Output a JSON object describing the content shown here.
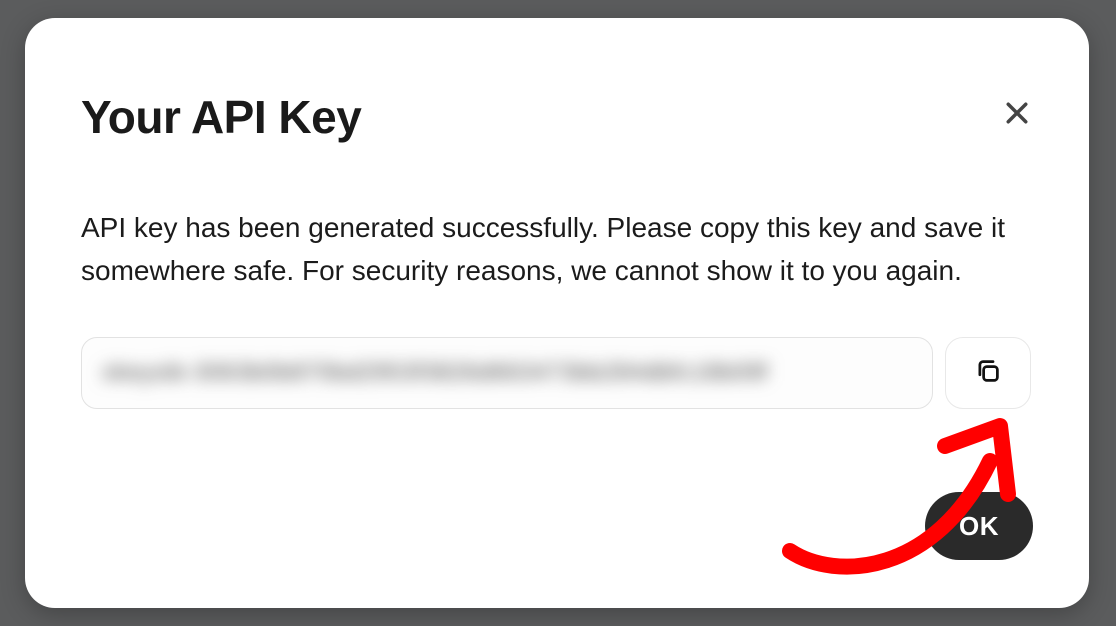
{
  "modal": {
    "title": "Your API Key",
    "description": "API key has been generated successfully. Please copy this key and save it somewhere safe. For security reasons, we cannot show it to you again.",
    "api_key_value": "xkeysib-3063b0b870bd2953f3826d663473bb284dbfc18b09f",
    "ok_label": "OK"
  },
  "icons": {
    "close": "close-icon",
    "copy": "copy-icon"
  },
  "annotation": {
    "type": "arrow",
    "color": "#ff0000",
    "target": "copy-button"
  }
}
